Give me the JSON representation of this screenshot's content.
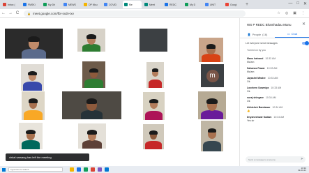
{
  "browser": {
    "tabs": [
      {
        "label": "Inbox (",
        "color": "#db4437"
      },
      {
        "label": "FMSKi",
        "color": "#1a73e8"
      },
      {
        "label": "My Dri",
        "color": "#0f9d58"
      },
      {
        "label": "MEWS",
        "color": "#4285f4"
      },
      {
        "label": "DP Mou",
        "color": "#f4b400"
      },
      {
        "label": "COVID",
        "color": "#4285f4"
      },
      {
        "label": "Me",
        "color": "#00897b",
        "active": true
      },
      {
        "label": "Meet",
        "color": "#00897b"
      },
      {
        "label": "REDC",
        "color": "#1a73e8"
      },
      {
        "label": "My D",
        "color": "#0f9d58"
      },
      {
        "label": "UNIT",
        "color": "#4285f4"
      },
      {
        "label": "Googl",
        "color": "#ea4335"
      }
    ],
    "new_tab": "+",
    "url": "meet.google.com/fbr-sxdv-txv",
    "nav": {
      "back": "←",
      "forward": "→",
      "reload": "C"
    },
    "window_controls": {
      "minimize": "—",
      "maximize": "□",
      "close": "✕"
    },
    "address_icons": [
      "☆",
      "◎",
      "▣",
      "⋮"
    ]
  },
  "toast": "virkal sarsang has left the meeting",
  "tiles": [
    {
      "name": "",
      "bg": "#2b2b2b",
      "kind": "person",
      "skin": "#c08b6a",
      "shirt": "#5b6b8c"
    },
    {
      "name": "",
      "bg": "#d7d2c8",
      "kind": "person",
      "skin": "#b37d5c",
      "shirt": "#2e7d32"
    },
    {
      "name": "",
      "bg": "#3c4043",
      "kind": "empty"
    },
    {
      "name": "",
      "bg": "#c9a58a",
      "kind": "person",
      "skin": "#a8714f",
      "shirt": "#d84315"
    },
    {
      "name": "",
      "bg": "#e0dcd5",
      "kind": "person",
      "skin": "#c08b6a",
      "shirt": "#3949ab"
    },
    {
      "name": "",
      "bg": "#6d5b4a",
      "kind": "person",
      "skin": "#8d5a3c",
      "shirt": "#2e7d32"
    },
    {
      "name": "",
      "bg": "#d9d4c9",
      "kind": "person",
      "skin": "#b37d5c",
      "shirt": "#c62828"
    },
    {
      "name": "",
      "bg": "#3c4043",
      "kind": "avatar",
      "letter": "m",
      "color": "#795548"
    },
    {
      "name": "",
      "bg": "#ddd6c6",
      "kind": "person",
      "skin": "#a8714f",
      "shirt": "#f9a825"
    },
    {
      "name": "",
      "bg": "#4e4a44",
      "kind": "person",
      "skin": "#8d5a3c",
      "shirt": "#263238"
    },
    {
      "name": "",
      "bg": "#d8d2c2",
      "kind": "person",
      "skin": "#b37d5c",
      "shirt": "#ad1457"
    },
    {
      "name": "",
      "bg": "#b6aa94",
      "kind": "person",
      "skin": "#a8714f",
      "shirt": "#6a1b9a"
    },
    {
      "name": "",
      "bg": "#e8e4dc",
      "kind": "person",
      "skin": "#a8714f",
      "shirt": "#00695c"
    },
    {
      "name": "",
      "bg": "#e4e0d8",
      "kind": "person",
      "skin": "#b37d5c",
      "shirt": "#5d4037"
    },
    {
      "name": "",
      "bg": "#d0c9bb",
      "kind": "person",
      "skin": "#8d5a3c",
      "shirt": "#c62828"
    },
    {
      "name": "",
      "bg": "#bfb6a4",
      "kind": "person",
      "skin": "#a8714f",
      "shirt": "#37474f"
    }
  ],
  "panel": {
    "title": "WS P REDC Bhamhadau Manu",
    "close": "✕",
    "tabs": {
      "people": "People",
      "people_count": "(16)",
      "chat": "Chat"
    },
    "setting": "Let everyone send messages",
    "info": "Turned on by you",
    "messages": [
      {
        "who": "Manu halvand",
        "time": "10:33 AM",
        "text": "Ma'am"
      },
      {
        "who": "Sahanas Pawar",
        "time": "10:33 AM",
        "text": "Ma'am"
      },
      {
        "who": "Jayashri Mhatre",
        "time": "10:33 AM",
        "text": "Ok"
      },
      {
        "who": "Loveleen Sowmiya",
        "time": "10:33 AM",
        "text": "Ok"
      },
      {
        "who": "suraj shingare",
        "time": "10:34 AM",
        "text": "Ok"
      },
      {
        "who": "Abhishek Bandawar",
        "time": "10:34 AM",
        "text": "👍"
      },
      {
        "who": "Dnyaneshwar Kadam",
        "time": "10:34 AM",
        "text": "Yes sir"
      }
    ],
    "input_placeholder": "Send a message to everyone",
    "send": "➤"
  },
  "taskbar": {
    "search_placeholder": "Type here to search",
    "time": "10:34",
    "date": "19-03-21",
    "icons": [
      "#f4b400",
      "#1a73e8",
      "#0f9d58",
      "#db4437",
      "#7e57c2",
      "#0078d4"
    ]
  }
}
